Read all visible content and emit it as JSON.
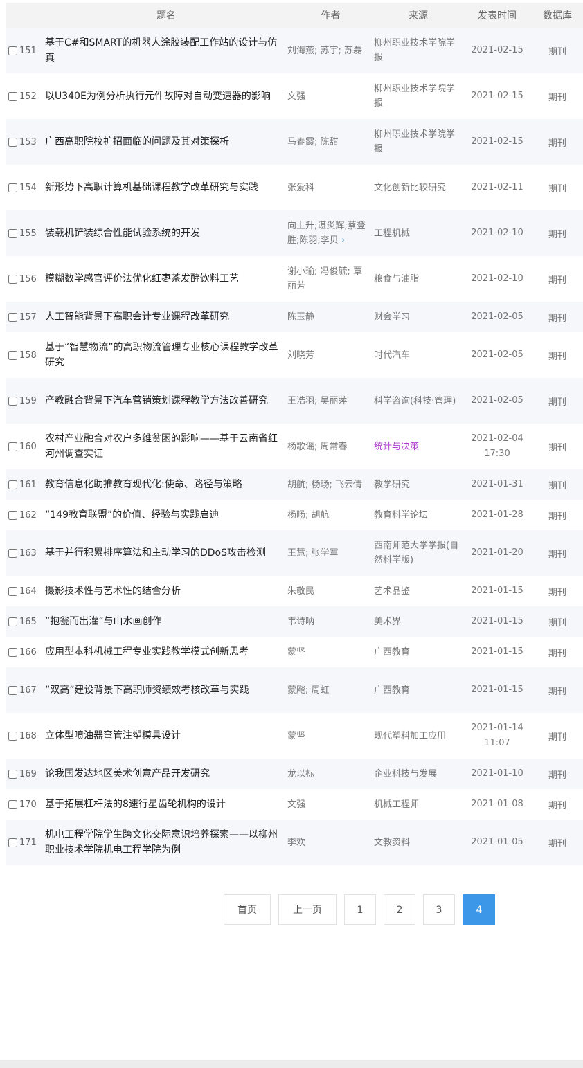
{
  "header": {
    "title": "题名",
    "author": "作者",
    "source": "来源",
    "date": "发表时间",
    "db": "数据库"
  },
  "rows": [
    {
      "num": "151",
      "title": "基于C#和SMART的机器人涂胶装配工作站的设计与仿真",
      "author": "刘海燕; 苏宇; 苏磊",
      "source": "柳州职业技术学院学报",
      "date": "2021-02-15",
      "db": "期刊"
    },
    {
      "num": "152",
      "title": "以U340E为例分析执行元件故障对自动变速器的影响",
      "author": "文强",
      "source": "柳州职业技术学院学报",
      "date": "2021-02-15",
      "db": "期刊"
    },
    {
      "num": "153",
      "title": "广西高职院校扩招面临的问题及其对策探析",
      "author": "马春霞; 陈甜",
      "source": "柳州职业技术学院学报",
      "date": "2021-02-15",
      "db": "期刊"
    },
    {
      "num": "154",
      "title": "新形势下高职计算机基础课程教学改革研究与实践",
      "author": "张爱科",
      "source": "文化创新比较研究",
      "date": "2021-02-11",
      "db": "期刊"
    },
    {
      "num": "155",
      "title": "装载机铲装综合性能试验系统的开发",
      "author": "向上升;谌炎辉;蔡登胜;陈羽;李贝",
      "source": "工程机械",
      "date": "2021-02-10",
      "db": "期刊",
      "more": true
    },
    {
      "num": "156",
      "title": "模糊数学感官评价法优化红枣茶发酵饮料工艺",
      "author": "谢小瑜; 冯俊毓; 覃丽芳",
      "source": "粮食与油脂",
      "date": "2021-02-10",
      "db": "期刊"
    },
    {
      "num": "157",
      "title": "人工智能背景下高职会计专业课程改革研究",
      "author": "陈玉静",
      "source": "财会学习",
      "date": "2021-02-05",
      "db": "期刊"
    },
    {
      "num": "158",
      "title": "基于“智慧物流”的高职物流管理专业核心课程教学改革研究",
      "author": "刘晓芳",
      "source": "时代汽车",
      "date": "2021-02-05",
      "db": "期刊"
    },
    {
      "num": "159",
      "title": "产教融合背景下汽车营销策划课程教学方法改善研究",
      "author": "王浩羽; 吴丽萍",
      "source": "科学咨询(科技·管理)",
      "date": "2021-02-05",
      "db": "期刊"
    },
    {
      "num": "160",
      "title": "农村产业融合对农户多维贫困的影响——基于云南省红河州调查实证",
      "author": "杨歌谣; 周常春",
      "source": "统计与决策",
      "date": "2021-02-04 17:30",
      "db": "期刊",
      "highlight": true
    },
    {
      "num": "161",
      "title": "教育信息化助推教育现代化:使命、路径与策略",
      "author": "胡航; 杨旸; 飞云倩",
      "source": "教学研究",
      "date": "2021-01-31",
      "db": "期刊"
    },
    {
      "num": "162",
      "title": "“149教育联盟”的价值、经验与实践启迪",
      "author": "杨旸; 胡航",
      "source": "教育科学论坛",
      "date": "2021-01-28",
      "db": "期刊"
    },
    {
      "num": "163",
      "title": "基于并行积累排序算法和主动学习的DDoS攻击检测",
      "author": "王慧; 张学军",
      "source": "西南师范大学学报(自然科学版)",
      "date": "2021-01-20",
      "db": "期刊"
    },
    {
      "num": "164",
      "title": "摄影技术性与艺术性的结合分析",
      "author": "朱敬民",
      "source": "艺术品鉴",
      "date": "2021-01-15",
      "db": "期刊"
    },
    {
      "num": "165",
      "title": "“抱瓮而出灌”与山水画创作",
      "author": "韦诗呐",
      "source": "美术界",
      "date": "2021-01-15",
      "db": "期刊"
    },
    {
      "num": "166",
      "title": "应用型本科机械工程专业实践教学模式创新思考",
      "author": "蒙坚",
      "source": "广西教育",
      "date": "2021-01-15",
      "db": "期刊"
    },
    {
      "num": "167",
      "title": "“双高”建设背景下高职师资绩效考核改革与实践",
      "author": "蒙飚; 周虹",
      "source": "广西教育",
      "date": "2021-01-15",
      "db": "期刊"
    },
    {
      "num": "168",
      "title": "立体型喷油器弯管注塑模具设计",
      "author": "蒙坚",
      "source": "现代塑料加工应用",
      "date": "2021-01-14 11:07",
      "db": "期刊"
    },
    {
      "num": "169",
      "title": "论我国发达地区美术创意产品开发研究",
      "author": "龙以标",
      "source": "企业科技与发展",
      "date": "2021-01-10",
      "db": "期刊"
    },
    {
      "num": "170",
      "title": "基于拓展杠杆法的8速行星齿轮机构的设计",
      "author": "文强",
      "source": "机械工程师",
      "date": "2021-01-08",
      "db": "期刊"
    },
    {
      "num": "171",
      "title": "机电工程学院学生跨文化交际意识培养探索——以柳州职业技术学院机电工程学院为例",
      "author": "李欢",
      "source": "文教资料",
      "date": "2021-01-05",
      "db": "期刊"
    }
  ],
  "pager": {
    "first": "首页",
    "prev": "上一页",
    "pages": [
      "1",
      "2",
      "3",
      "4"
    ],
    "current": "4"
  },
  "colors": {
    "accent": "#3d97e8",
    "highlight_source": "#b03fcf",
    "row_alt": "#f5f7fa"
  }
}
